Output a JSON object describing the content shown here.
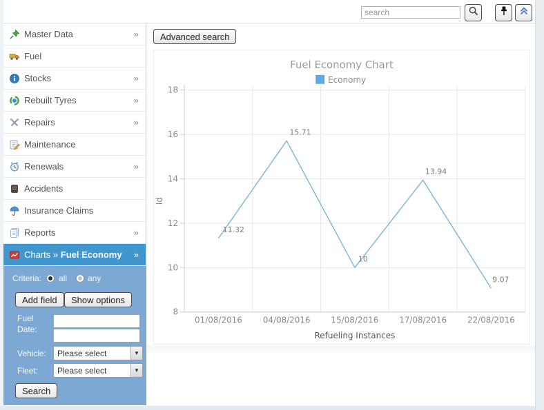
{
  "header": {
    "search_placeholder": "search",
    "icons": [
      "search-icon",
      "pushpin-icon",
      "collapse-icon"
    ]
  },
  "sidebar": {
    "items": [
      {
        "label": "Master Data",
        "icon": "pin-icon",
        "chevron": "»"
      },
      {
        "label": "Fuel",
        "icon": "fuel-truck-icon",
        "chevron": ""
      },
      {
        "label": "Stocks",
        "icon": "info-icon",
        "chevron": "»"
      },
      {
        "label": "Rebuilt Tyres",
        "icon": "tyre-icon",
        "chevron": "»"
      },
      {
        "label": "Repairs",
        "icon": "tools-icon",
        "chevron": "»"
      },
      {
        "label": "Maintenance",
        "icon": "clipboard-icon",
        "chevron": ""
      },
      {
        "label": "Renewals",
        "icon": "clock-icon",
        "chevron": "»"
      },
      {
        "label": "Accidents",
        "icon": "accident-icon",
        "chevron": ""
      },
      {
        "label": "Insurance Claims",
        "icon": "umbrella-icon",
        "chevron": ""
      },
      {
        "label": "Reports",
        "icon": "report-icon",
        "chevron": "»"
      }
    ],
    "active_item": {
      "prefix": "Charts » ",
      "label": "Fuel Economy",
      "icon": "chart-icon",
      "chevron": "»"
    }
  },
  "filter_panel": {
    "criteria_label": "Criteria:",
    "criteria_options": [
      {
        "label": "all",
        "selected": true
      },
      {
        "label": "any",
        "selected": false
      }
    ],
    "buttons": {
      "add_field": "Add field",
      "show_options": "Show options",
      "search": "Search"
    },
    "fuel_date_label": "Fuel Date:",
    "fuel_date_from": "",
    "fuel_date_to": "",
    "vehicle_label": "Vehicle:",
    "vehicle_value": "Please select",
    "fleet_label": "Fleet:",
    "fleet_value": "Please select"
  },
  "toolbar": {
    "advanced_search_label": "Advanced search"
  },
  "colors": {
    "accent": "#4196ce",
    "panel_blue": "#7da8d4"
  },
  "chart_data": {
    "type": "line",
    "title": "Fuel Economy Chart",
    "xlabel": "Refueling Instances",
    "ylabel": "Id",
    "categories": [
      "01/08/2016",
      "04/08/2016",
      "15/08/2016",
      "17/08/2016",
      "22/08/2016"
    ],
    "series": [
      {
        "name": "Economy",
        "values": [
          11.32,
          15.71,
          10,
          13.94,
          9.07
        ],
        "color": "#79b5d6"
      }
    ],
    "point_labels": [
      "11.32",
      "15.71",
      "10",
      "13.94",
      "9.07"
    ],
    "ylim": [
      8,
      18
    ],
    "yticks": [
      8,
      10,
      12,
      14,
      16,
      18
    ],
    "grid": true,
    "legend": [
      {
        "label": "Economy",
        "color": "#5ea9e2"
      }
    ],
    "legend_position": "top-center"
  }
}
